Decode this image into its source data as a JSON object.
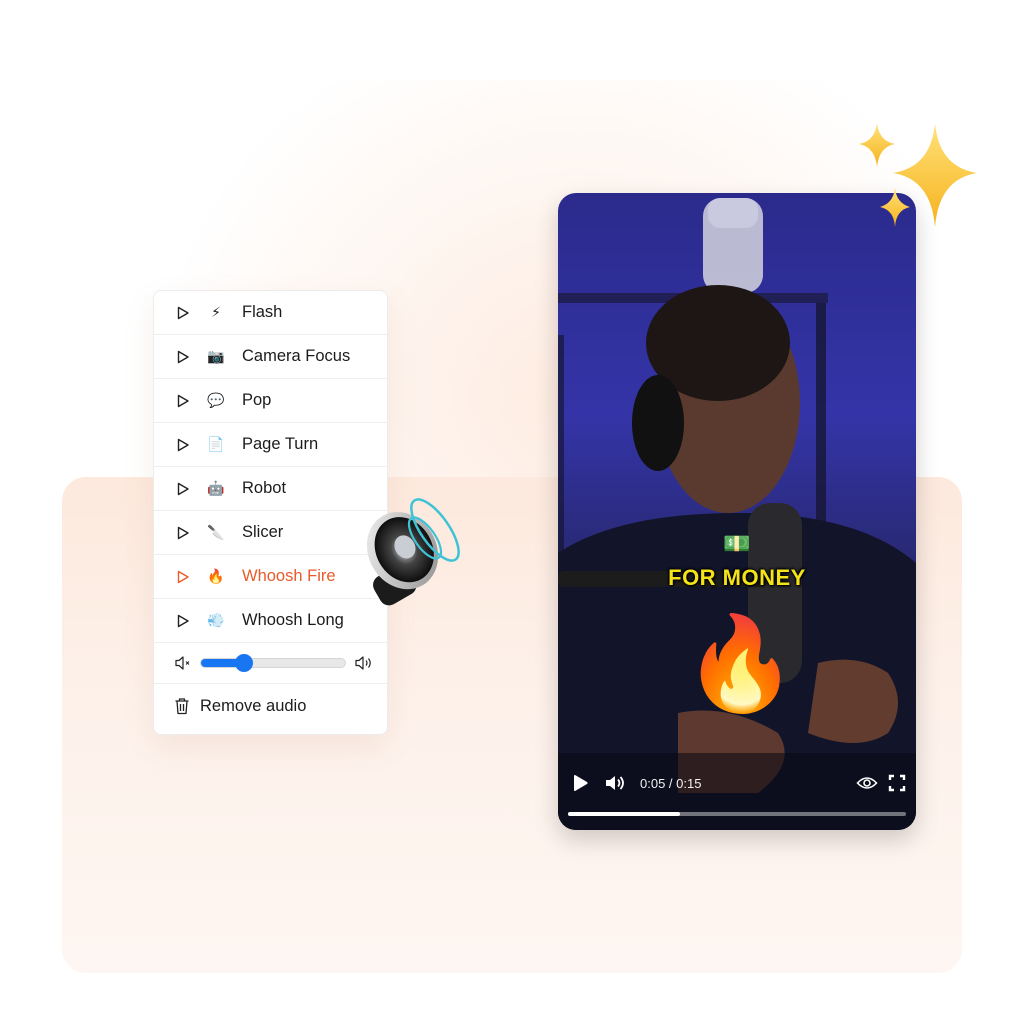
{
  "sound_menu": {
    "items": [
      {
        "label": "Flash",
        "emoji": "⚡",
        "icon": "lightning-icon",
        "active": false
      },
      {
        "label": "Camera Focus",
        "emoji": "📷",
        "icon": "camera-icon",
        "active": false
      },
      {
        "label": "Pop",
        "emoji": "💬",
        "icon": "speech-bubble-icon",
        "active": false
      },
      {
        "label": "Page Turn",
        "emoji": "📄",
        "icon": "page-icon",
        "active": false
      },
      {
        "label": "Robot",
        "emoji": "🤖",
        "icon": "robot-icon",
        "active": false
      },
      {
        "label": "Slicer",
        "emoji": "🔪",
        "icon": "knife-icon",
        "active": false
      },
      {
        "label": "Whoosh Fire",
        "emoji": "🔥",
        "icon": "fire-icon",
        "active": true
      },
      {
        "label": "Whoosh Long",
        "emoji": "💨",
        "icon": "dash-icon",
        "active": false
      }
    ],
    "volume": 0.3,
    "remove_label": "Remove audio"
  },
  "video": {
    "caption_emoji": "💵",
    "caption": "FOR MONEY",
    "overlay_emoji": "🔥",
    "time_display": "0:05 / 0:15",
    "progress": 0.33
  },
  "colors": {
    "accent": "#ea5b2a",
    "slider": "#1976f2",
    "caption": "#f4e318"
  }
}
